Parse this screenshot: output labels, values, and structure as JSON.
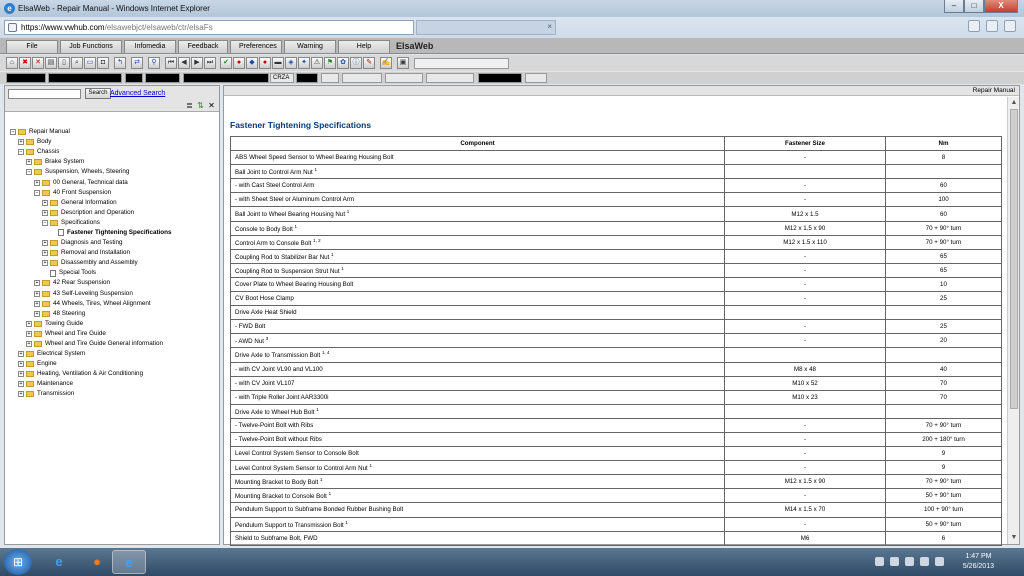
{
  "window": {
    "title": "ElsaWeb - Repair Manual - Windows Internet Explorer",
    "controls": [
      "–",
      "□",
      "X"
    ]
  },
  "address": {
    "scheme": "https://",
    "host": "www.vwhub.com",
    "path": "/elsawebjct/elsaweb/ctr/elsaFs"
  },
  "menu": {
    "tabs": [
      "File",
      "Job Functions",
      "Infomedia",
      "Feedback",
      "Preferences",
      "Warning",
      "Help"
    ],
    "brand": "ElsaWeb"
  },
  "fieldrow": {
    "code": "CRZA"
  },
  "search": {
    "button": "Search",
    "advanced": "Advanced Search"
  },
  "tree": [
    {
      "label": "Repair Manual",
      "level": 0,
      "type": "folder",
      "exp": "−"
    },
    {
      "label": "Body",
      "level": 1,
      "type": "folder",
      "exp": "+"
    },
    {
      "label": "Chassis",
      "level": 1,
      "type": "folder",
      "exp": "−"
    },
    {
      "label": "Brake System",
      "level": 2,
      "type": "folder",
      "exp": "+"
    },
    {
      "label": "Suspension, Wheels, Steering",
      "level": 2,
      "type": "folder",
      "exp": "−"
    },
    {
      "label": "00 General, Technical data",
      "level": 3,
      "type": "folder",
      "exp": "+"
    },
    {
      "label": "40 Front Suspension",
      "level": 3,
      "type": "folder",
      "exp": "−"
    },
    {
      "label": "General Information",
      "level": 4,
      "type": "folder",
      "exp": "+"
    },
    {
      "label": "Description and Operation",
      "level": 4,
      "type": "folder",
      "exp": "+"
    },
    {
      "label": "Specifications",
      "level": 4,
      "type": "folder",
      "exp": "−"
    },
    {
      "label": "Fastener Tightening Specifications",
      "level": 5,
      "type": "doc",
      "exp": "",
      "selected": true
    },
    {
      "label": "Diagnosis and Testing",
      "level": 4,
      "type": "folder",
      "exp": "+"
    },
    {
      "label": "Removal and Installation",
      "level": 4,
      "type": "folder",
      "exp": "+"
    },
    {
      "label": "Disassembly and Assembly",
      "level": 4,
      "type": "folder",
      "exp": "+"
    },
    {
      "label": "Special Tools",
      "level": 4,
      "type": "doc",
      "exp": ""
    },
    {
      "label": "42 Rear Suspension",
      "level": 3,
      "type": "folder",
      "exp": "+"
    },
    {
      "label": "43 Self-Leveling Suspension",
      "level": 3,
      "type": "folder",
      "exp": "+"
    },
    {
      "label": "44 Wheels, Tires, Wheel Alignment",
      "level": 3,
      "type": "folder",
      "exp": "+"
    },
    {
      "label": "48 Steering",
      "level": 3,
      "type": "folder",
      "exp": "+"
    },
    {
      "label": "Towing Guide",
      "level": 2,
      "type": "folder",
      "exp": "+"
    },
    {
      "label": "Wheel and Tire Guide",
      "level": 2,
      "type": "folder",
      "exp": "+"
    },
    {
      "label": "Wheel and Tire Guide General information",
      "level": 2,
      "type": "folder",
      "exp": "+"
    },
    {
      "label": "Electrical System",
      "level": 1,
      "type": "folder",
      "exp": "+"
    },
    {
      "label": "Engine",
      "level": 1,
      "type": "folder",
      "exp": "+"
    },
    {
      "label": "Heating, Ventilation & Air Conditioning",
      "level": 1,
      "type": "folder",
      "exp": "+"
    },
    {
      "label": "Maintenance",
      "level": 1,
      "type": "folder",
      "exp": "+"
    },
    {
      "label": "Transmission",
      "level": 1,
      "type": "folder",
      "exp": "+"
    }
  ],
  "content": {
    "header_label": "Repair Manual",
    "title": "Fastener Tightening Specifications",
    "columns": [
      "Component",
      "Fastener Size",
      "Nm"
    ],
    "rows": [
      {
        "c": "ABS Wheel Speed Sensor to Wheel Bearing Housing Bolt",
        "sup": "",
        "size": "-",
        "nm": "8"
      },
      {
        "c": "Ball Joint to Control Arm Nut",
        "sup": "1",
        "size": "",
        "nm": ""
      },
      {
        "c": "- with Cast Steel Control Arm",
        "sup": "",
        "size": "-",
        "nm": "60"
      },
      {
        "c": "- with Sheet Steel or Aluminum Control Arm",
        "sup": "",
        "size": "-",
        "nm": "100"
      },
      {
        "c": "Ball Joint to Wheel Bearing Housing Nut",
        "sup": "1",
        "size": "M12 x 1.5",
        "nm": "60"
      },
      {
        "c": "Console to Body Bolt",
        "sup": "1",
        "size": "M12 x 1.5 x 90",
        "nm": "70 + 90° turn"
      },
      {
        "c": "Control Arm to Console Bolt",
        "sup": "1, 2",
        "size": "M12 x 1.5 x 110",
        "nm": "70 + 90° turn"
      },
      {
        "c": "Coupling Rod to Stabilizer Bar Nut",
        "sup": "1",
        "size": "-",
        "nm": "65"
      },
      {
        "c": "Coupling Rod to Suspension Strut Nut",
        "sup": "1",
        "size": "-",
        "nm": "65"
      },
      {
        "c": "Cover Plate to Wheel Bearing Housing Bolt",
        "sup": "",
        "size": "-",
        "nm": "10"
      },
      {
        "c": "CV Boot Hose Clamp",
        "sup": "",
        "size": "-",
        "nm": "25"
      },
      {
        "c": "Drive Axle Heat Shield",
        "sup": "",
        "size": "",
        "nm": ""
      },
      {
        "c": "- FWD Bolt",
        "sup": "",
        "size": "-",
        "nm": "25"
      },
      {
        "c": "- AWD Nut",
        "sup": "3",
        "size": "-",
        "nm": "20"
      },
      {
        "c": "Drive Axle to Transmission Bolt",
        "sup": "1, 4",
        "size": "",
        "nm": ""
      },
      {
        "c": "- with CV Joint VL90 and VL100",
        "sup": "",
        "size": "M8 x 48",
        "nm": "40"
      },
      {
        "c": "- with CV Joint VL107",
        "sup": "",
        "size": "M10 x 52",
        "nm": "70"
      },
      {
        "c": "- with Triple Roller Joint AAR3300i",
        "sup": "",
        "size": "M10 x 23",
        "nm": "70"
      },
      {
        "c": "Drive Axle to Wheel Hub Bolt",
        "sup": "1",
        "size": "",
        "nm": ""
      },
      {
        "c": "- Twelve-Point Bolt with Ribs",
        "sup": "",
        "size": "-",
        "nm": "70 + 90° turn"
      },
      {
        "c": "- Twelve-Point Bolt without Ribs",
        "sup": "",
        "size": "-",
        "nm": "200 + 180° turn"
      },
      {
        "c": "Level Control System Sensor to Console Bolt",
        "sup": "",
        "size": "-",
        "nm": "9"
      },
      {
        "c": "Level Control System Sensor to Control Arm Nut",
        "sup": "1",
        "size": "-",
        "nm": "9"
      },
      {
        "c": "Mounting Bracket to Body Bolt",
        "sup": "1",
        "size": "M12 x 1.5 x 90",
        "nm": "70 + 90° turn"
      },
      {
        "c": "Mounting Bracket to Console Bolt",
        "sup": "1",
        "size": "-",
        "nm": "50 + 90° turn"
      },
      {
        "c": "Pendulum Support to Subframe Bonded Rubber Bushing Bolt",
        "sup": "",
        "size": "M14 x 1.5 x 70",
        "nm": "100 + 90° turn"
      },
      {
        "c": "Pendulum Support to Transmission Bolt",
        "sup": "1",
        "size": "-",
        "nm": "50 + 90° turn"
      },
      {
        "c": "Shield to Subframe Bolt, FWD",
        "sup": "",
        "size": "M6",
        "nm": "6"
      }
    ]
  },
  "taskbar": {
    "time": "1:47 PM",
    "date": "5/26/2013"
  }
}
